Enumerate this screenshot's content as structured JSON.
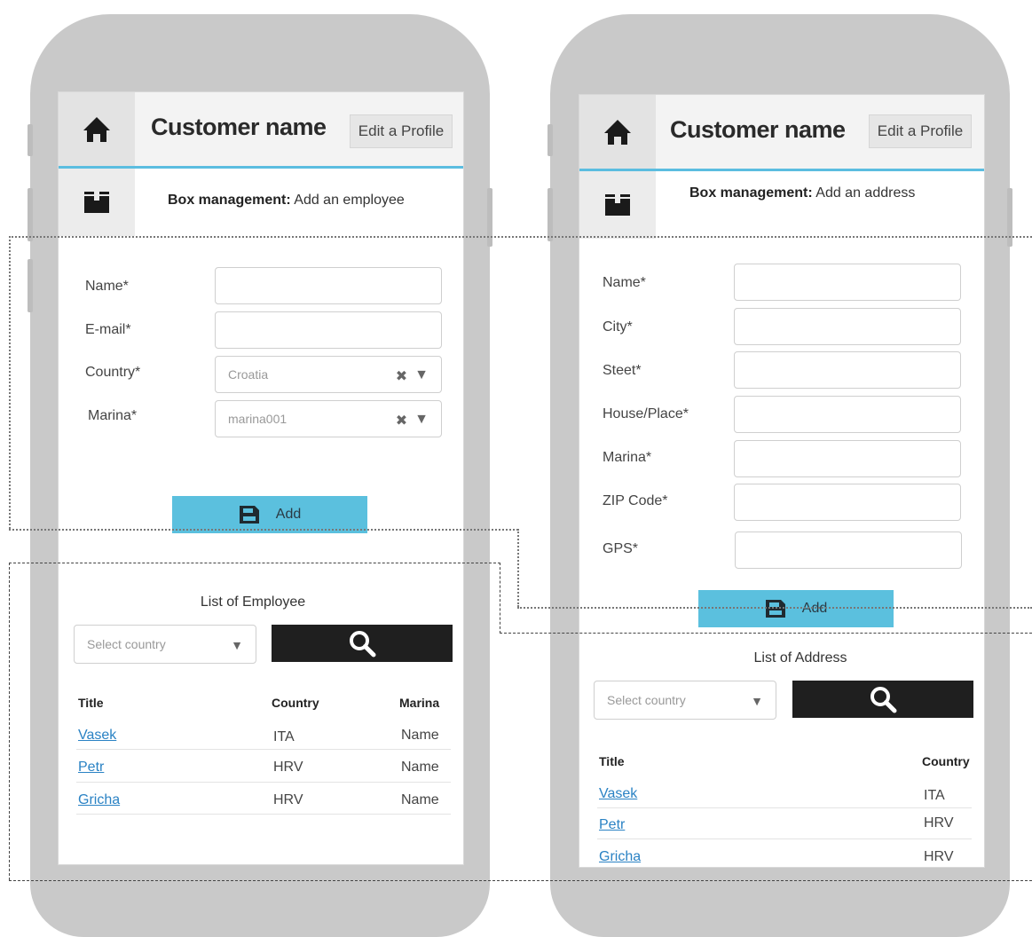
{
  "left_screen": {
    "header": {
      "title": "Customer name",
      "edit_label": "Edit a Profile"
    },
    "box": {
      "label": "Box management:",
      "action": "Add an employee"
    },
    "form": {
      "name_label": "Name*",
      "email_label": "E-mail*",
      "country_label": "Country*",
      "country_value": "Croatia",
      "marina_label": "Marina*",
      "marina_value": "marina001"
    },
    "add_label": "Add",
    "list": {
      "title": "List of Employee",
      "select_placeholder": "Select country",
      "columns": [
        "Title",
        "Country",
        "Marina"
      ],
      "rows": [
        {
          "title": "Vasek",
          "country": "ITA",
          "marina": "Name"
        },
        {
          "title": "Petr",
          "country": "HRV",
          "marina": "Name"
        },
        {
          "title": "Gricha",
          "country": "HRV",
          "marina": "Name"
        }
      ]
    }
  },
  "right_screen": {
    "header": {
      "title": "Customer name",
      "edit_label": "Edit a Profile"
    },
    "box": {
      "label": "Box management:",
      "action": "Add an address"
    },
    "form": {
      "name_label": "Name*",
      "city_label": "City*",
      "street_label": "Steet*",
      "house_label": "House/Place*",
      "marina_label": "Marina*",
      "zip_label": "ZIP Code*",
      "gps_label": "GPS*"
    },
    "add_label": "Add",
    "list": {
      "title": "List of Address",
      "select_placeholder": "Select country",
      "columns": [
        "Title",
        "Country"
      ],
      "rows": [
        {
          "title": "Vasek",
          "country": "ITA"
        },
        {
          "title": "Petr",
          "country": "HRV"
        },
        {
          "title": "Gricha",
          "country": "HRV"
        }
      ]
    }
  },
  "colors": {
    "accent": "#5bc0de",
    "header_rule": "#5bbde0",
    "search_bg": "#1f1f1f",
    "link": "#2a82c4",
    "phone": "#c9c9c9"
  },
  "icons": [
    "home-icon",
    "box-icon",
    "save-icon",
    "search-icon",
    "clear-icon",
    "dropdown-arrow-icon"
  ]
}
